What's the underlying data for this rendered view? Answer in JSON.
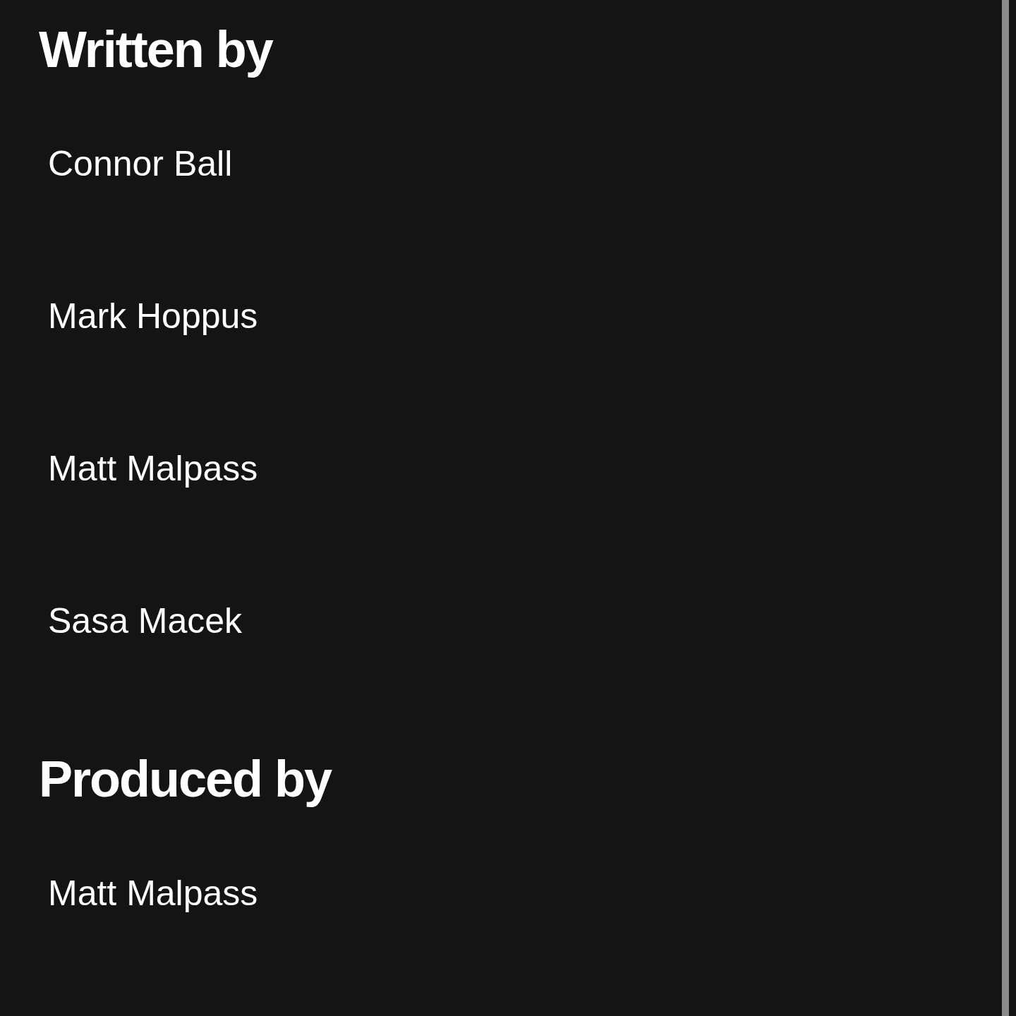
{
  "sections": [
    {
      "title": "Written by",
      "people": [
        "Connor Ball",
        "Mark Hoppus",
        "Matt Malpass",
        "Sasa Macek"
      ]
    },
    {
      "title": "Produced by",
      "people": [
        "Matt Malpass"
      ]
    }
  ]
}
